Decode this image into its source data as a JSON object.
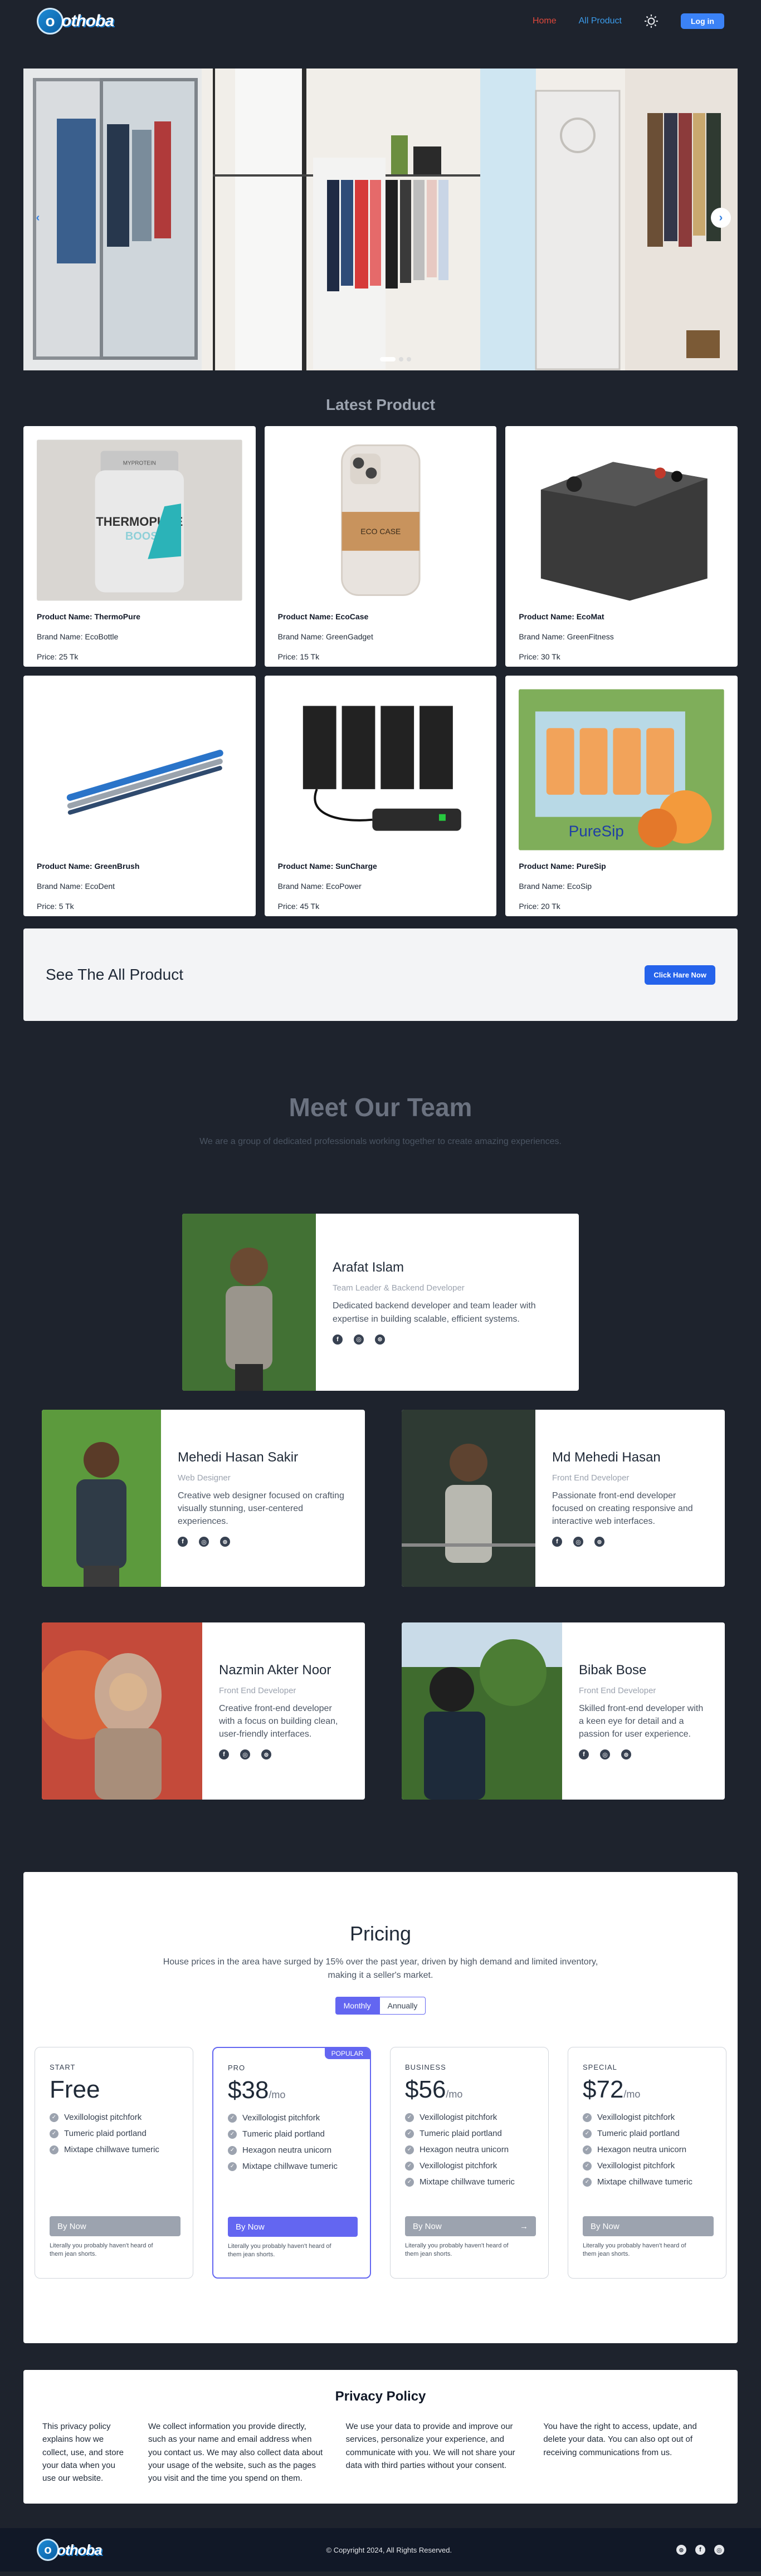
{
  "nav": {
    "brand": "othoba",
    "home": "Home",
    "all_product": "All Product",
    "login": "Log in",
    "icons": [
      "sun-icon"
    ]
  },
  "hero": {
    "slides": 3,
    "active_slide": 1
  },
  "latest": {
    "title": "Latest Product",
    "products": [
      {
        "name": "Product Name: ThermoPure",
        "brand": "Brand Name: EcoBottle",
        "price": "Price: 25 Tk"
      },
      {
        "name": "Product Name: EcoCase",
        "brand": "Brand Name: GreenGadget",
        "price": "Price: 15 Tk"
      },
      {
        "name": "Product Name: EcoMat",
        "brand": "Brand Name: GreenFitness",
        "price": "Price: 30 Tk"
      },
      {
        "name": "Product Name: GreenBrush",
        "brand": "Brand Name: EcoDent",
        "price": "Price: 5 Tk"
      },
      {
        "name": "Product Name: SunCharge",
        "brand": "Brand Name: EcoPower",
        "price": "Price: 45 Tk"
      },
      {
        "name": "Product Name: PureSip",
        "brand": "Brand Name: EcoSip",
        "price": "Price: 20 Tk"
      }
    ],
    "image_labels": {
      "thermo_top": "MYPROTEIN",
      "thermo_a": "THERMOPURE",
      "thermo_b": "BOOST",
      "ecocase": "ECO CASE",
      "puresip": "PureSip"
    }
  },
  "cta": {
    "title": "See The All Product",
    "button": "Click Hare Now"
  },
  "team": {
    "title": "Meet Our Team",
    "subtitle": "We are a group of dedicated professionals working together to create amazing experiences.",
    "members": [
      {
        "name": "Arafat Islam",
        "role": "Team Leader & Backend Developer",
        "bio": "Dedicated backend developer and team leader with expertise in building scalable, efficient systems."
      },
      {
        "name": "Mehedi Hasan Sakir",
        "role": "Web Designer",
        "bio": "Creative web designer focused on crafting visually stunning, user-centered experiences."
      },
      {
        "name": "Md Mehedi Hasan",
        "role": "Front End Developer",
        "bio": "Passionate front-end developer focused on creating responsive and interactive web interfaces."
      },
      {
        "name": "Nazmin Akter Noor",
        "role": "Front End Developer",
        "bio": "Creative front-end developer with a focus on building clean, user-friendly interfaces."
      },
      {
        "name": "Bibak Bose",
        "role": "Front End Developer",
        "bio": "Skilled front-end developer with a keen eye for detail and a passion for user experience."
      }
    ],
    "social_icons": [
      "facebook-icon",
      "github-icon",
      "dribbble-icon"
    ]
  },
  "pricing": {
    "title": "Pricing",
    "subtitle": "House prices in the area have surged by 15% over the past year, driven by high demand and limited inventory, making it a seller's market.",
    "monthly": "Monthly",
    "annually": "Annually",
    "popular": "POPULAR",
    "fine": "Literally you probably haven't heard of them jean shorts.",
    "plans": [
      {
        "tag": "START",
        "price": "Free",
        "per": "",
        "button": "By Now",
        "features": [
          "Vexillologist pitchfork",
          "Tumeric plaid portland",
          "Mixtape chillwave tumeric"
        ]
      },
      {
        "tag": "PRO",
        "price": "$38",
        "per": "/mo",
        "button": "By Now",
        "features": [
          "Vexillologist pitchfork",
          "Tumeric plaid portland",
          "Hexagon neutra unicorn",
          "Mixtape chillwave tumeric"
        ]
      },
      {
        "tag": "BUSINESS",
        "price": "$56",
        "per": "/mo",
        "button": "By Now",
        "features": [
          "Vexillologist pitchfork",
          "Tumeric plaid portland",
          "Hexagon neutra unicorn",
          "Vexillologist pitchfork",
          "Mixtape chillwave tumeric"
        ]
      },
      {
        "tag": "SPECIAL",
        "price": "$72",
        "per": "/mo",
        "button": "By Now",
        "features": [
          "Vexillologist pitchfork",
          "Tumeric plaid portland",
          "Hexagon neutra unicorn",
          "Vexillologist pitchfork",
          "Mixtape chillwave tumeric"
        ]
      }
    ]
  },
  "privacy": {
    "title": "Privacy Policy",
    "cols": [
      "This privacy policy explains how we collect, use, and store your data when you use our website.",
      "We collect information you provide directly, such as your name and email address when you contact us. We may also collect data about your usage of the website, such as the pages you visit and the time you spend on them.",
      "We use your data to provide and improve our services, personalize your experience, and communicate with you. We will not share your data with third parties without your consent.",
      "You have the right to access, update, and delete your data. You can also opt out of receiving communications from us."
    ]
  },
  "footer": {
    "brand": "othoba",
    "copyright": "© Copyright 2024, All Rights Reserved."
  },
  "colors": {
    "accent": "#3b82f6",
    "indigo": "#6366f1",
    "bg": "#1e232d",
    "home": "#e0483b"
  }
}
